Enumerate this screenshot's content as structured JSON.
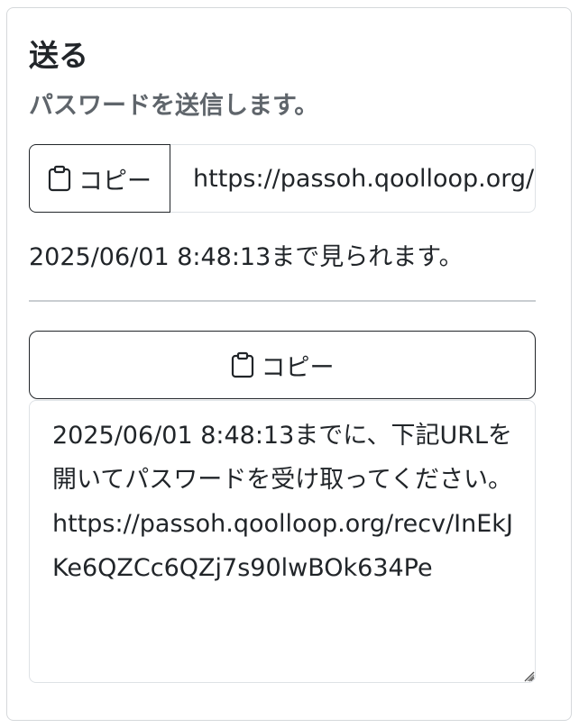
{
  "card": {
    "title": "送る",
    "subtitle": "パスワードを送信します。"
  },
  "share": {
    "copy_label": "コピー",
    "copy_icon": "clipboard-icon",
    "url": "https://passoh.qoolloop.org/recv/InEkJKe6QZCc6QZj7s90lwBOk634Pe",
    "expiry_text": "2025/06/01 8:48:13まで見られます。"
  },
  "message": {
    "copy_label": "コピー",
    "copy_icon": "clipboard-icon",
    "text": "2025/06/01 8:48:13までに、下記URLを開いてパスワードを受け取ってください。\nhttps://passoh.qoolloop.org/recv/InEkJKe6QZCc6QZj7s90lwBOk634Pe"
  },
  "colors": {
    "text": "#212529",
    "muted": "#5f656b",
    "border": "#dee2e6"
  }
}
